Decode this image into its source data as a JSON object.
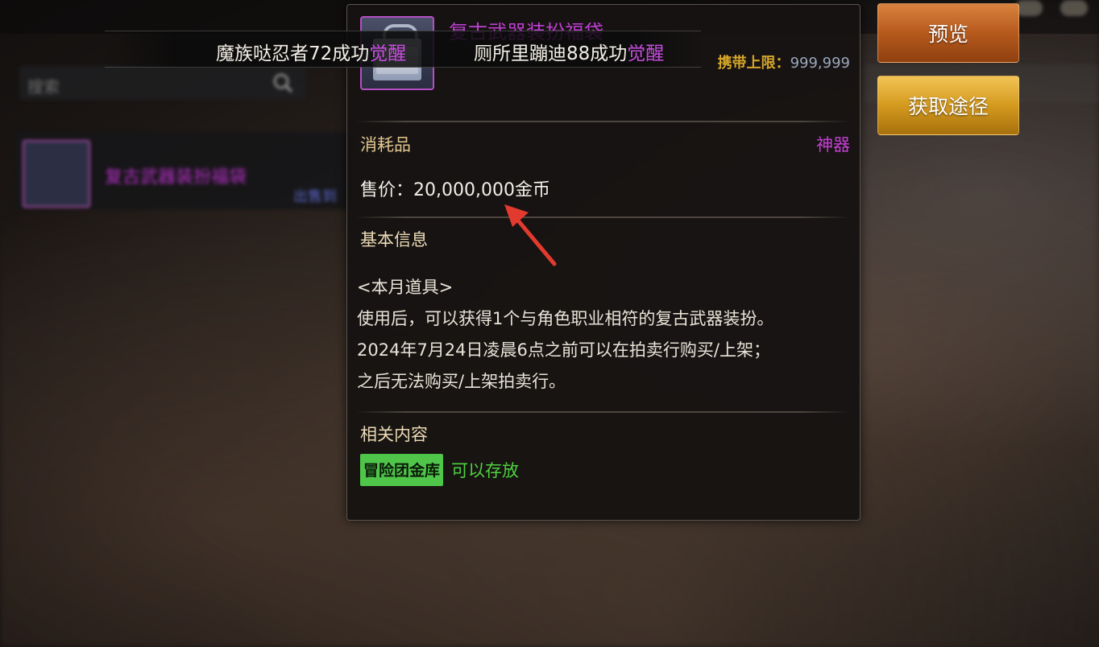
{
  "background": {
    "search_placeholder": "搜索"
  },
  "inventory": {
    "item_name": "复古武器装扮福袋",
    "item_sub": "出售到"
  },
  "ticker": {
    "msg1_prefix": "魔族哒忍者72成功",
    "msg1_highlight": "觉醒",
    "msg2_prefix": "厕所里蹦迪88成功",
    "msg2_highlight": "觉醒"
  },
  "tooltip": {
    "title": "复古武器装扮福袋",
    "carry_label": "携带上限：",
    "carry_value": "999,999",
    "category": "消耗品",
    "grade": "神器",
    "price": "售价：20,000,000金币",
    "basic_info_title": "基本信息",
    "description": [
      "<本月道具>",
      "使用后，可以获得1个与角色职业相符的复古武器装扮。",
      "2024年7月24日凌晨6点之前可以在拍卖行购买/上架；",
      "之后无法购买/上架拍卖行。"
    ],
    "related_title": "相关内容",
    "tag_label": "冒险团金库",
    "tag_note": "可以存放"
  },
  "buttons": {
    "preview": "预览",
    "obtain": "获取途径"
  },
  "colors": {
    "epic_purple": "#c23fd6",
    "gold_label": "#d6a629",
    "green_tag": "#4fc64a",
    "arrow_red": "#e23a2e"
  }
}
